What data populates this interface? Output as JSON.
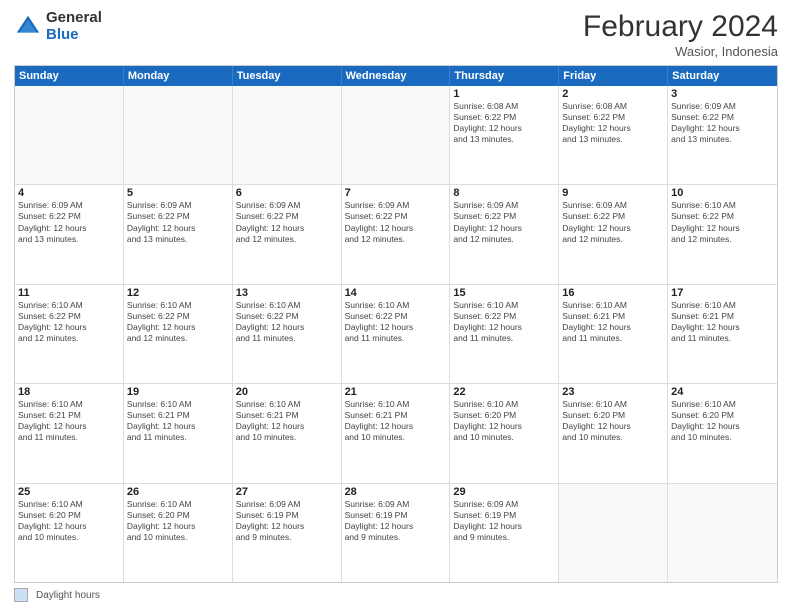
{
  "logo": {
    "general": "General",
    "blue": "Blue"
  },
  "title": {
    "month": "February 2024",
    "location": "Wasior, Indonesia"
  },
  "header_days": [
    "Sunday",
    "Monday",
    "Tuesday",
    "Wednesday",
    "Thursday",
    "Friday",
    "Saturday"
  ],
  "rows": [
    [
      {
        "day": "",
        "info": ""
      },
      {
        "day": "",
        "info": ""
      },
      {
        "day": "",
        "info": ""
      },
      {
        "day": "",
        "info": ""
      },
      {
        "day": "1",
        "info": "Sunrise: 6:08 AM\nSunset: 6:22 PM\nDaylight: 12 hours\nand 13 minutes."
      },
      {
        "day": "2",
        "info": "Sunrise: 6:08 AM\nSunset: 6:22 PM\nDaylight: 12 hours\nand 13 minutes."
      },
      {
        "day": "3",
        "info": "Sunrise: 6:09 AM\nSunset: 6:22 PM\nDaylight: 12 hours\nand 13 minutes."
      }
    ],
    [
      {
        "day": "4",
        "info": "Sunrise: 6:09 AM\nSunset: 6:22 PM\nDaylight: 12 hours\nand 13 minutes."
      },
      {
        "day": "5",
        "info": "Sunrise: 6:09 AM\nSunset: 6:22 PM\nDaylight: 12 hours\nand 13 minutes."
      },
      {
        "day": "6",
        "info": "Sunrise: 6:09 AM\nSunset: 6:22 PM\nDaylight: 12 hours\nand 12 minutes."
      },
      {
        "day": "7",
        "info": "Sunrise: 6:09 AM\nSunset: 6:22 PM\nDaylight: 12 hours\nand 12 minutes."
      },
      {
        "day": "8",
        "info": "Sunrise: 6:09 AM\nSunset: 6:22 PM\nDaylight: 12 hours\nand 12 minutes."
      },
      {
        "day": "9",
        "info": "Sunrise: 6:09 AM\nSunset: 6:22 PM\nDaylight: 12 hours\nand 12 minutes."
      },
      {
        "day": "10",
        "info": "Sunrise: 6:10 AM\nSunset: 6:22 PM\nDaylight: 12 hours\nand 12 minutes."
      }
    ],
    [
      {
        "day": "11",
        "info": "Sunrise: 6:10 AM\nSunset: 6:22 PM\nDaylight: 12 hours\nand 12 minutes."
      },
      {
        "day": "12",
        "info": "Sunrise: 6:10 AM\nSunset: 6:22 PM\nDaylight: 12 hours\nand 12 minutes."
      },
      {
        "day": "13",
        "info": "Sunrise: 6:10 AM\nSunset: 6:22 PM\nDaylight: 12 hours\nand 11 minutes."
      },
      {
        "day": "14",
        "info": "Sunrise: 6:10 AM\nSunset: 6:22 PM\nDaylight: 12 hours\nand 11 minutes."
      },
      {
        "day": "15",
        "info": "Sunrise: 6:10 AM\nSunset: 6:22 PM\nDaylight: 12 hours\nand 11 minutes."
      },
      {
        "day": "16",
        "info": "Sunrise: 6:10 AM\nSunset: 6:21 PM\nDaylight: 12 hours\nand 11 minutes."
      },
      {
        "day": "17",
        "info": "Sunrise: 6:10 AM\nSunset: 6:21 PM\nDaylight: 12 hours\nand 11 minutes."
      }
    ],
    [
      {
        "day": "18",
        "info": "Sunrise: 6:10 AM\nSunset: 6:21 PM\nDaylight: 12 hours\nand 11 minutes."
      },
      {
        "day": "19",
        "info": "Sunrise: 6:10 AM\nSunset: 6:21 PM\nDaylight: 12 hours\nand 11 minutes."
      },
      {
        "day": "20",
        "info": "Sunrise: 6:10 AM\nSunset: 6:21 PM\nDaylight: 12 hours\nand 10 minutes."
      },
      {
        "day": "21",
        "info": "Sunrise: 6:10 AM\nSunset: 6:21 PM\nDaylight: 12 hours\nand 10 minutes."
      },
      {
        "day": "22",
        "info": "Sunrise: 6:10 AM\nSunset: 6:20 PM\nDaylight: 12 hours\nand 10 minutes."
      },
      {
        "day": "23",
        "info": "Sunrise: 6:10 AM\nSunset: 6:20 PM\nDaylight: 12 hours\nand 10 minutes."
      },
      {
        "day": "24",
        "info": "Sunrise: 6:10 AM\nSunset: 6:20 PM\nDaylight: 12 hours\nand 10 minutes."
      }
    ],
    [
      {
        "day": "25",
        "info": "Sunrise: 6:10 AM\nSunset: 6:20 PM\nDaylight: 12 hours\nand 10 minutes."
      },
      {
        "day": "26",
        "info": "Sunrise: 6:10 AM\nSunset: 6:20 PM\nDaylight: 12 hours\nand 10 minutes."
      },
      {
        "day": "27",
        "info": "Sunrise: 6:09 AM\nSunset: 6:19 PM\nDaylight: 12 hours\nand 9 minutes."
      },
      {
        "day": "28",
        "info": "Sunrise: 6:09 AM\nSunset: 6:19 PM\nDaylight: 12 hours\nand 9 minutes."
      },
      {
        "day": "29",
        "info": "Sunrise: 6:09 AM\nSunset: 6:19 PM\nDaylight: 12 hours\nand 9 minutes."
      },
      {
        "day": "",
        "info": ""
      },
      {
        "day": "",
        "info": ""
      }
    ]
  ],
  "footer": {
    "legend_label": "Daylight hours"
  }
}
